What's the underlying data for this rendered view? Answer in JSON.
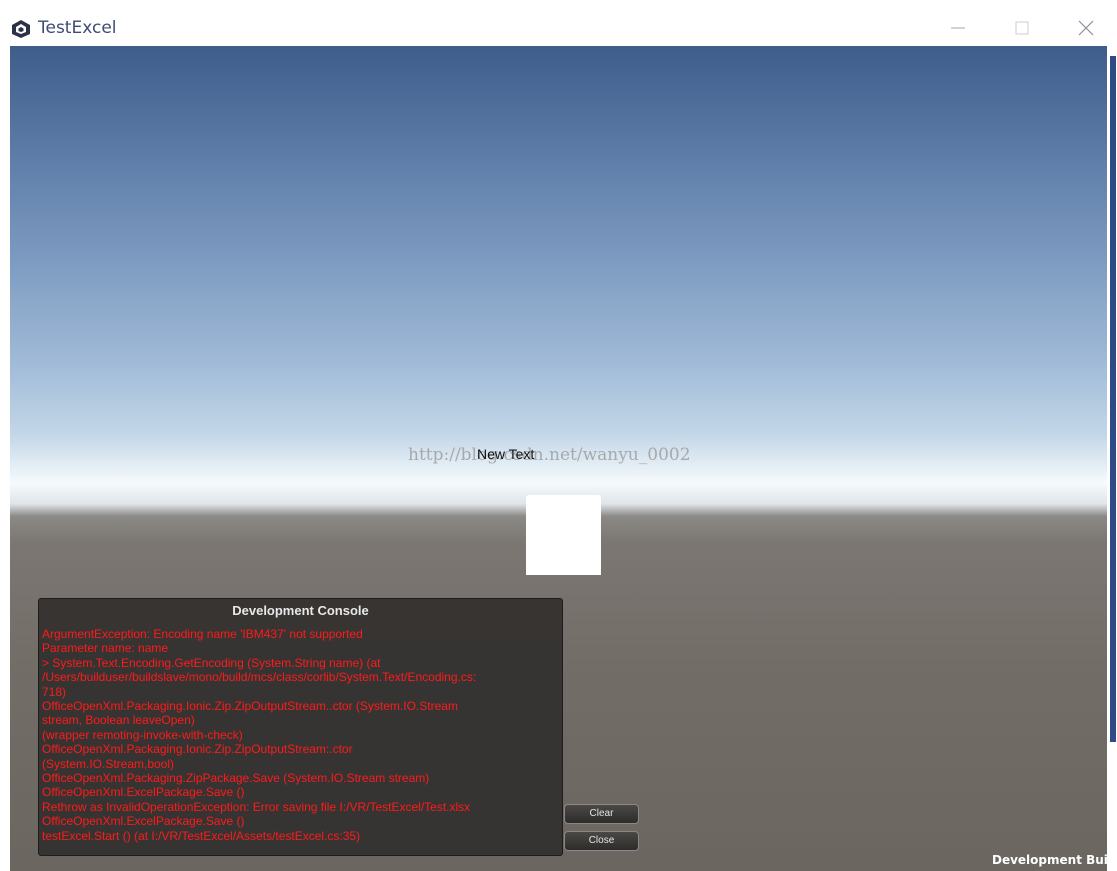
{
  "window": {
    "title": "TestExcel",
    "icon": "unity-logo-icon",
    "controls": {
      "minimize": "minimize-icon",
      "maximize": "maximize-icon",
      "close": "close-icon"
    }
  },
  "scene": {
    "watermark": "http://blog.csdn.net/wanyu_0002",
    "ui_text": "New Text"
  },
  "console": {
    "title": "Development Console",
    "log_color": "#ff1a1a",
    "lines": [
      "ArgumentException: Encoding name 'IBM437' not supported",
      "Parameter name: name",
      "> System.Text.Encoding.GetEncoding (System.String name) (at",
      "/Users/builduser/buildslave/mono/build/mcs/class/corlib/System.Text/Encoding.cs:",
      "718)",
      "OfficeOpenXml.Packaging.Ionic.Zip.ZipOutputStream..ctor (System.IO.Stream",
      "stream, Boolean leaveOpen)",
      "(wrapper remoting-invoke-with-check)",
      "OfficeOpenXml.Packaging.Ionic.Zip.ZipOutputStream:.ctor",
      "(System.IO.Stream,bool)",
      "OfficeOpenXml.Packaging.ZipPackage.Save (System.IO.Stream stream)",
      "OfficeOpenXml.ExcelPackage.Save ()",
      "Rethrow as InvalidOperationException: Error saving file I:/VR/TestExcel/Test.xlsx",
      "OfficeOpenXml.ExcelPackage.Save ()",
      "testExcel.Start () (at I:/VR/TestExcel/Assets/testExcel.cs:35)"
    ],
    "clear_label": "Clear",
    "close_label": "Close"
  },
  "footer": {
    "build_label": "Development Build"
  }
}
